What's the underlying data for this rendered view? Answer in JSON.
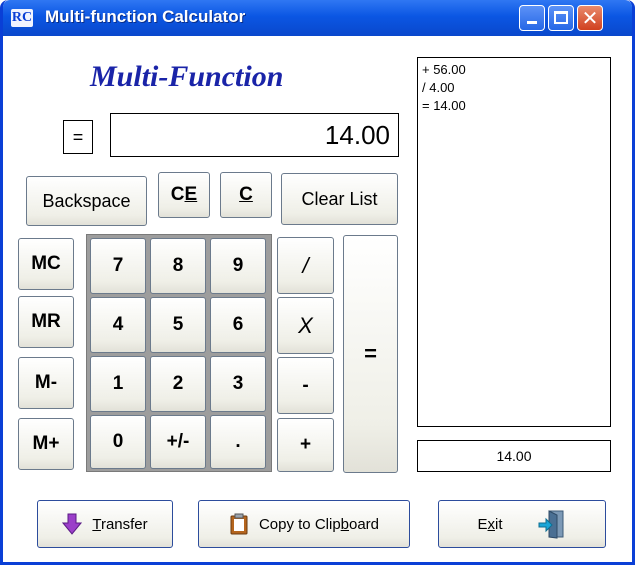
{
  "window": {
    "app_icon": "RC",
    "title": "Multi-function Calculator",
    "close_glyph": "✕"
  },
  "brand": "Multi-Function",
  "display": {
    "operator": "=",
    "value": "14.00"
  },
  "top_buttons": {
    "backspace": "Backspace",
    "ce_prefix": "C",
    "ce_underlined": "E",
    "c_underlined": "C",
    "clear_list": "Clear List"
  },
  "memory": [
    "MC",
    "MR",
    "M-",
    "M+"
  ],
  "keypad": {
    "row1": [
      "7",
      "8",
      "9"
    ],
    "row2": [
      "4",
      "5",
      "6"
    ],
    "row3": [
      "1",
      "2",
      "3"
    ],
    "row4": [
      "0",
      "+/-",
      "."
    ]
  },
  "operators": {
    "divide": "/",
    "multiply": "X",
    "subtract": "-",
    "add": "+",
    "equals": "="
  },
  "history": [
    "+ 56.00",
    "/ 4.00",
    "= 14.00"
  ],
  "result": "14.00",
  "actions": {
    "transfer_underlined": "T",
    "transfer_rest": "ransfer",
    "copy_prefix": "Copy to Clip",
    "copy_underlined": "b",
    "copy_suffix": "oard",
    "exit_prefix": "E",
    "exit_underlined": "x",
    "exit_suffix": "it"
  },
  "icons": {
    "transfer": "arrow-down-icon",
    "copy": "clipboard-icon",
    "exit": "exit-door-icon"
  },
  "colors": {
    "titlebar": "#0b56e3",
    "brand": "#1a24a8"
  }
}
